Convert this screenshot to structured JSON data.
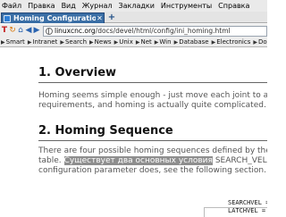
{
  "menubar": {
    "items": [
      "Файл",
      "Правка",
      "Вид",
      "Журнал",
      "Закладки",
      "Инструменты",
      "Справка"
    ]
  },
  "tabs": {
    "active_title": "Homing Configuration",
    "close_glyph": "✕",
    "new_tab_glyph": "+"
  },
  "navbar": {
    "url_host": "linuxcnc.org",
    "url_path": "/docs/devel/html/config/ini_homing.html"
  },
  "bookmarks": {
    "items": [
      "Smart",
      "Intranet",
      "Search",
      "News",
      "Unix",
      "Net",
      "Win",
      "Database",
      "Electronics",
      "Doc"
    ]
  },
  "page": {
    "section1_title": "1. Overview",
    "section1_line1": "Homing seems simple enough - just move each joint to a k",
    "section1_line2": "requirements, and homing is actually quite complicated.",
    "section2_title": "2. Homing Sequence",
    "section2_line1": "There are four possible homing sequences defined by the",
    "section2_line2_prefix": "table. ",
    "section2_line2_highlight": "Существует два основных условия",
    "section2_line2_suffix": " SEARCH_VEL a",
    "section2_line3": "configuration parameter does, see the following section.",
    "code_line1": "SEARCHVEL =",
    "code_line2": "LATCHVEL ="
  },
  "colors": {
    "tab_active": "#3a6ea5",
    "highlight": "#8e8e8e",
    "body_text": "#555555"
  }
}
